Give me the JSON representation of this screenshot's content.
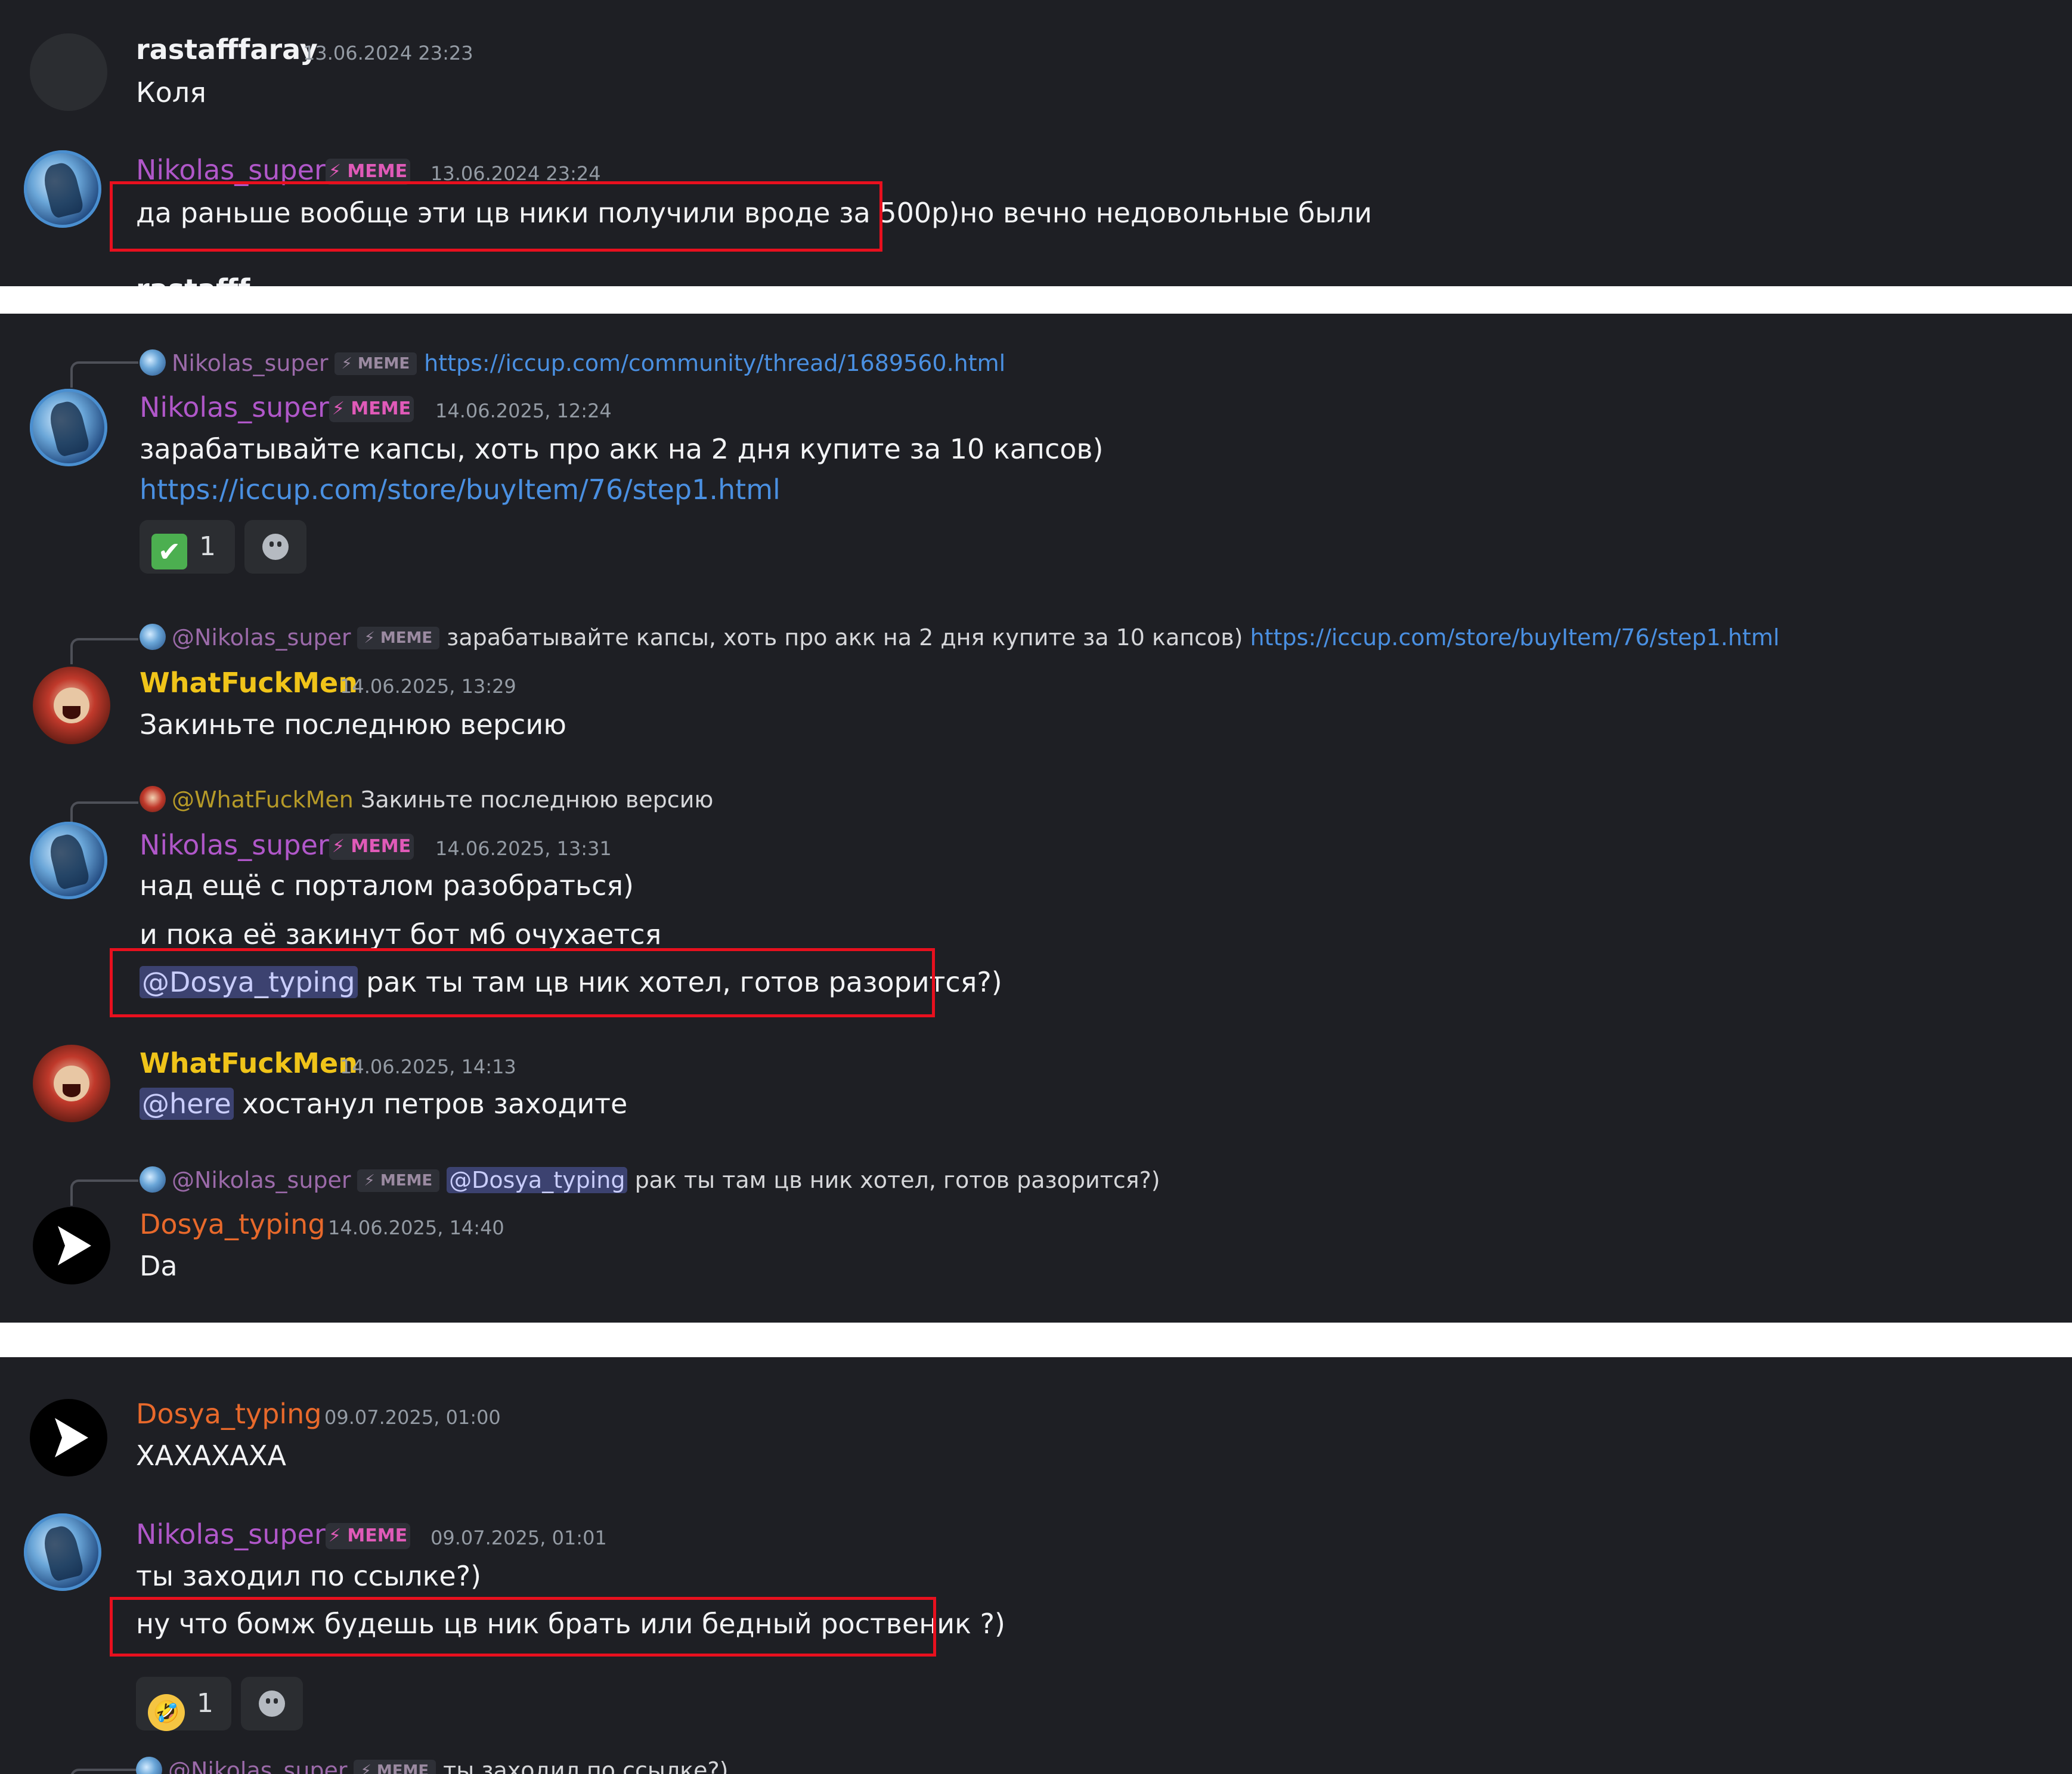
{
  "screenshot1": {
    "messages": [
      {
        "author": "rastafffaray",
        "timestamp": "13.06.2024 23:23",
        "text": "Коля"
      },
      {
        "author": "Nikolas_super",
        "tag": "⚡ MEME",
        "timestamp": "13.06.2024 23:24",
        "text_highlighted": "да раньше вообще эти цв ники получили вроде за 500р)",
        "text_rest": "но вечно недовольные были"
      },
      {
        "author_partial": "rastafff"
      }
    ]
  },
  "screenshot2": {
    "messages": [
      {
        "reply_author": "Nikolas_super",
        "reply_tag": "⚡ MEME",
        "reply_link": "https://iccup.com/community/thread/1689560.html",
        "author": "Nikolas_super",
        "tag": "⚡ MEME",
        "timestamp": "14.06.2025, 12:24",
        "text": "зарабатывайте капсы, хоть про акк на 2 дня купите за 10 капсов)",
        "link": "https://iccup.com/store/buyItem/76/step1.html",
        "reaction": {
          "emoji": "✔",
          "emoji_name": "check-mark",
          "count": "1"
        }
      },
      {
        "reply_author": "@Nikolas_super",
        "reply_tag": "⚡ MEME",
        "reply_text": "зарабатывайте капсы, хоть про акк на 2 дня купите за 10 капсов)",
        "reply_link": "https://iccup.com/store/buyItem/76/step1.html",
        "author": "WhatFuckMen",
        "timestamp": "14.06.2025, 13:29",
        "text": "Закиньте последнюю версию"
      },
      {
        "reply_author": "@WhatFuckMen",
        "reply_text": "Закиньте последнюю версию",
        "author": "Nikolas_super",
        "tag": "⚡ MEME",
        "timestamp": "14.06.2025, 13:31",
        "line1": "над ещё с порталом разобраться)",
        "line2": "и пока её закинут бот мб очухается",
        "mention": "@Dosya_typing",
        "line3": "рак ты там цв ник хотел, готов разорится?)"
      },
      {
        "author": "WhatFuckMen",
        "timestamp": "14.06.2025, 14:13",
        "mention": "@here",
        "text": "хостанул петров заходите"
      },
      {
        "reply_author": "@Nikolas_super",
        "reply_tag": "⚡ MEME",
        "reply_mention": "@Dosya_typing",
        "reply_text": "рак ты там цв ник хотел, готов разорится?)",
        "author": "Dosya_typing",
        "timestamp": "14.06.2025, 14:40",
        "text": "Da"
      }
    ]
  },
  "screenshot3": {
    "messages": [
      {
        "author": "Dosya_typing",
        "timestamp": "09.07.2025, 01:00",
        "text": "ХАХАХАХА"
      },
      {
        "author": "Nikolas_super",
        "tag": "⚡ MEME",
        "timestamp": "09.07.2025, 01:01",
        "line1": "ты заходил по ссылке?)",
        "line2": "ну что бомж будешь цв ник брать или бедный роственик ?)",
        "reaction": {
          "emoji": "🤣",
          "emoji_name": "rolling-laughing",
          "count": "1"
        }
      },
      {
        "reply_author_partial": "@Nikolas_super",
        "reply_tag": "⚡ MEME",
        "reply_text_partial": "ты заходил по ссылке?)"
      }
    ]
  },
  "colors": {
    "background": "#1e1f24",
    "highlight_box": "#e8101e",
    "nikolas": "#b057c9",
    "whatfuckmen": "#f0c419",
    "dosya": "#e8692b",
    "link": "#4a90e2"
  }
}
